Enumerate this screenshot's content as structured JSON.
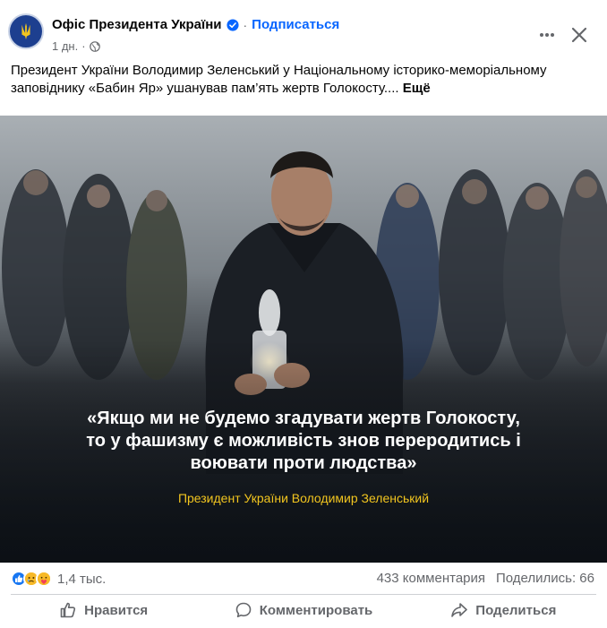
{
  "header": {
    "page_name": "Офіс Президента України",
    "separator": "·",
    "follow_label": "Подписаться",
    "time": "1 дн.",
    "meta_separator": "·",
    "icons": {
      "avatar": "trident-emblem-icon",
      "verified": "verified-badge-icon",
      "privacy": "globe-icon",
      "more": "more-horizontal-icon",
      "close": "close-icon"
    },
    "colors": {
      "link": "#0866ff",
      "secondary": "#65676b"
    }
  },
  "post": {
    "text": "Президент України Володимир Зеленський у Національному історико-меморіальному заповіднику «Бабин Яр» ушанував пам’ять жертв Голокосту....",
    "see_more": "Ещё"
  },
  "image": {
    "quote": "«Якщо ми не будемо згадувати жертв Голокосту, то у фашизму є можливість знов переродитись і воювати проти людства»",
    "quote_lines": [
      "«Якщо ми не будемо згадувати жертв Голокосту,",
      "то у фашизму є можливість знов переродитись і",
      "воювати проти людства»"
    ],
    "author": "Президент України Володимир Зеленський",
    "author_color": "#f2c51f"
  },
  "reactions": {
    "icons": [
      "like-icon",
      "sad-icon",
      "care-icon"
    ],
    "count": "1,4 тыс.",
    "comments": "433 комментария",
    "shares": "Поделились: 66"
  },
  "actions": {
    "like": "Нравится",
    "comment": "Комментировать",
    "share": "Поделиться"
  }
}
